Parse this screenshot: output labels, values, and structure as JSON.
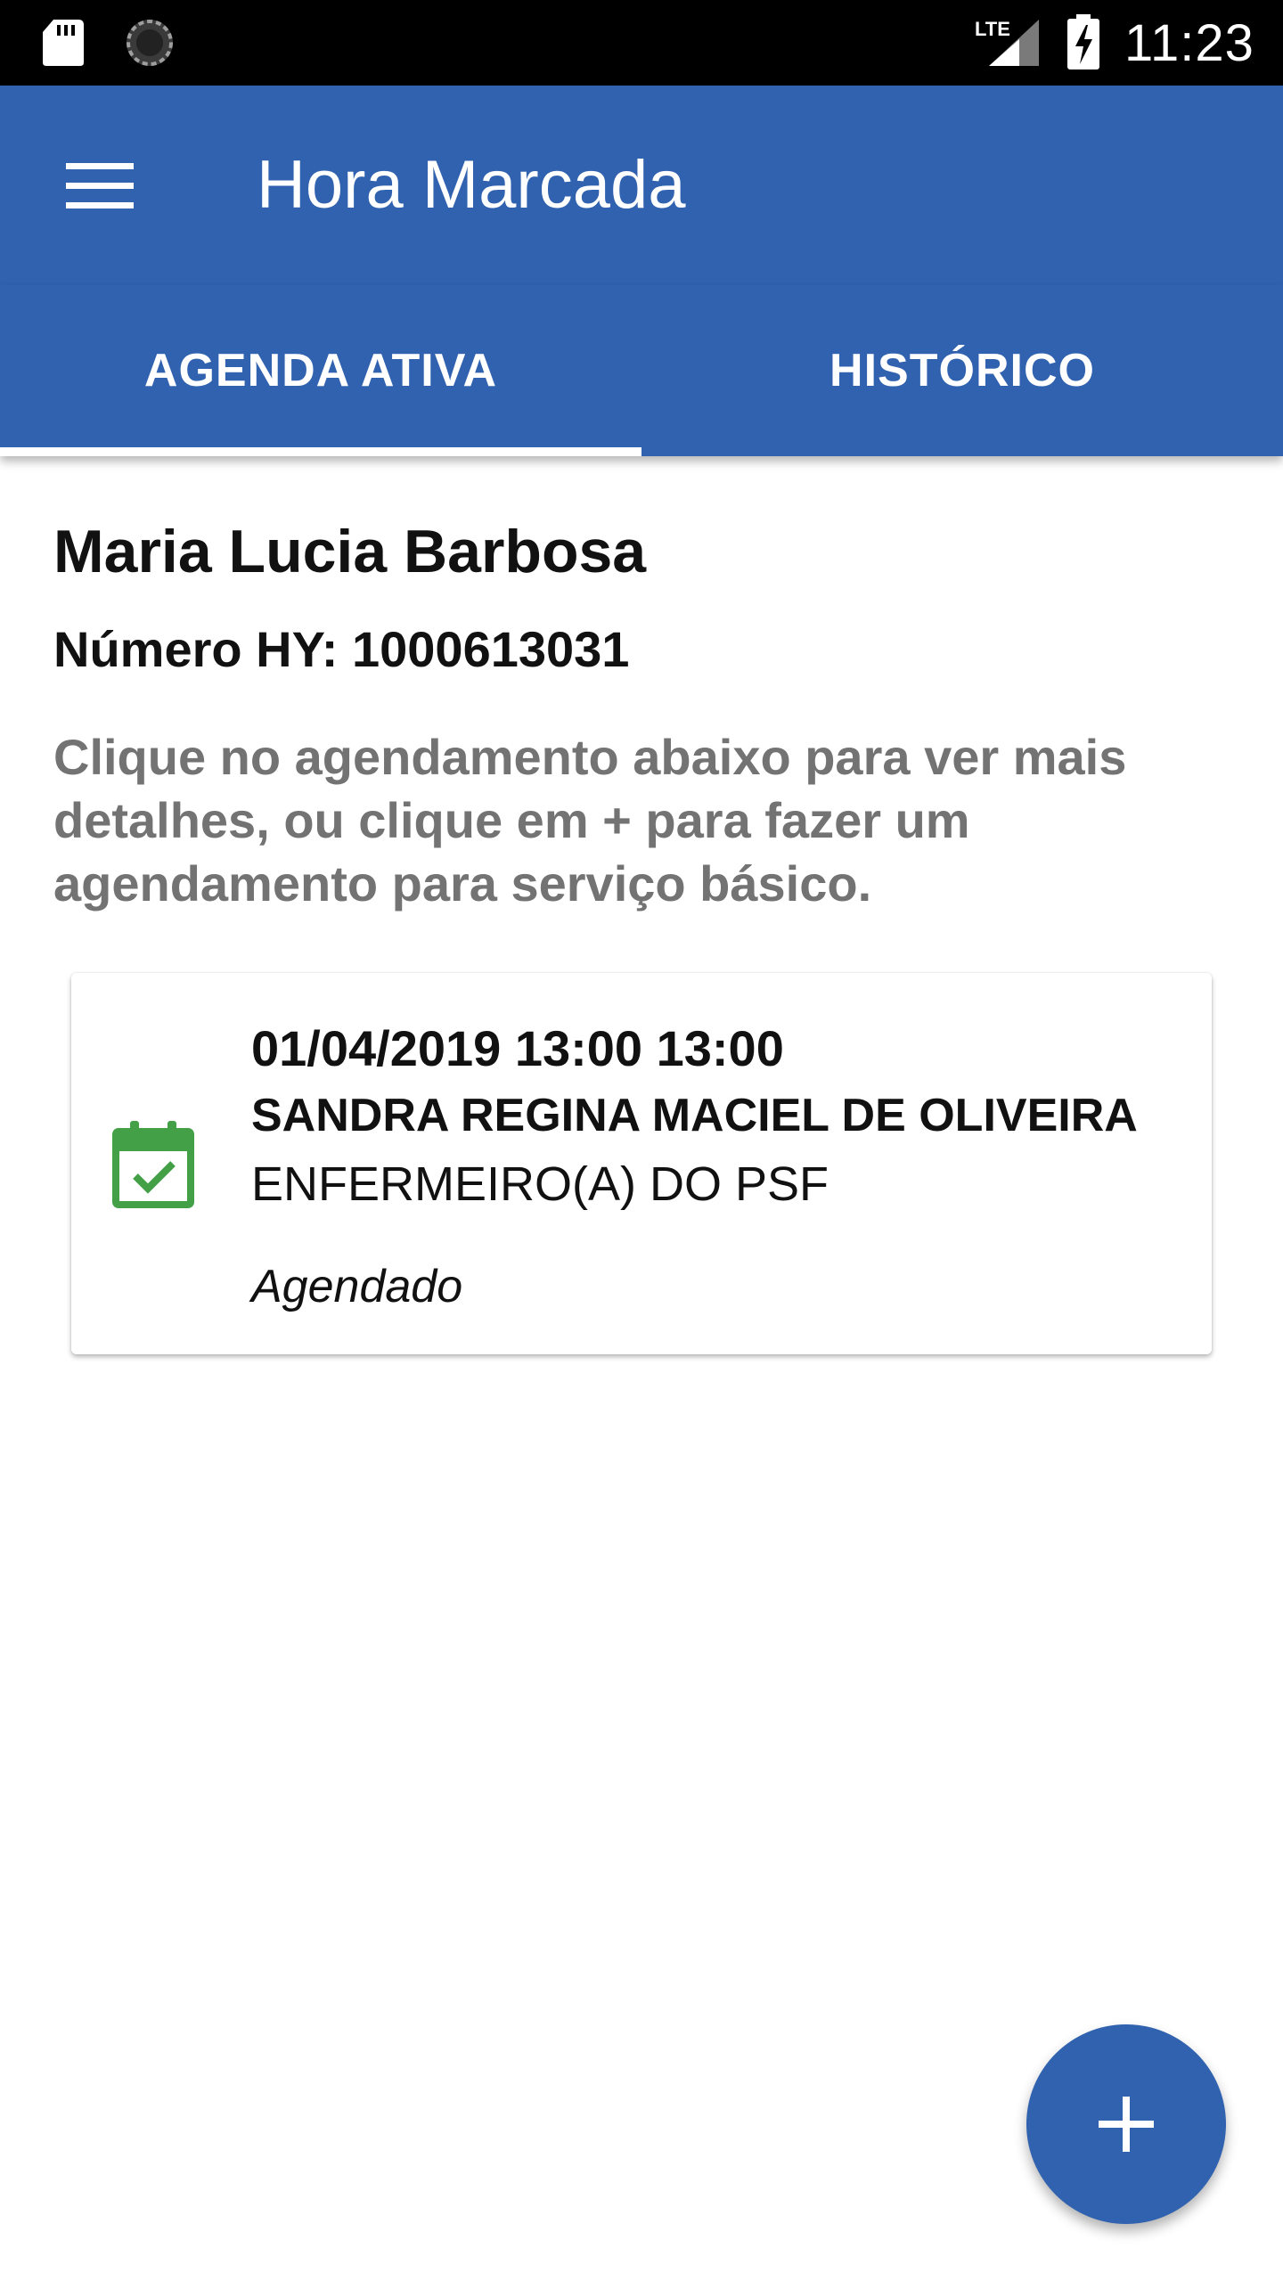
{
  "status_bar": {
    "time": "11:23",
    "network": "LTE",
    "icons": [
      "sd-card-icon",
      "sync-icon",
      "lte-signal-icon",
      "battery-charging-icon"
    ]
  },
  "app_bar": {
    "title": "Hora Marcada",
    "menu_icon": "menu-icon"
  },
  "tabs": [
    {
      "label": "AGENDA ATIVA",
      "selected": true
    },
    {
      "label": "HISTÓRICO",
      "selected": false
    }
  ],
  "patient": {
    "name": "Maria Lucia Barbosa",
    "number": "Número HY: 1000613031"
  },
  "instructions": "Clique no agendamento abaixo para ver mais detalhes, ou clique em + para fazer um agendamento para serviço básico.",
  "appointments": [
    {
      "datetime": "01/04/2019 13:00 13:00",
      "professional": "SANDRA REGINA MACIEL DE OLIVEIRA",
      "role": "ENFERMEIRO(A) DO PSF",
      "status": "Agendado",
      "icon": "calendar-check-icon"
    }
  ],
  "fab": {
    "icon": "plus-icon"
  },
  "colors": {
    "primary": "#3062b0",
    "calendar_icon": "#43a047",
    "secondary_text": "#737373"
  }
}
